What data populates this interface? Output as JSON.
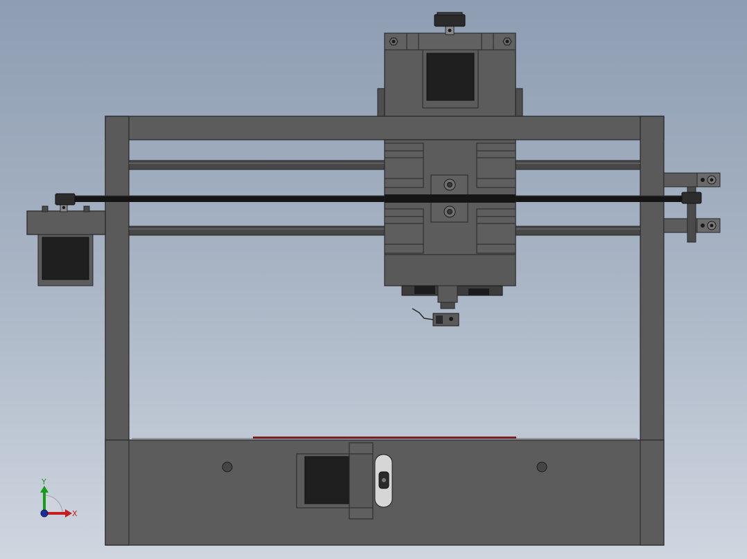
{
  "view": {
    "background_top": "#8e9db2",
    "background_bottom": "#cfd6e0"
  },
  "model": {
    "frame_color": "#5c5c5c",
    "frame_edge_color": "#262626",
    "motor_color": "#1f1f1f",
    "rod_color": "#474747",
    "belt_color": "#151515",
    "bed_accent_color": "#7a1f1f"
  },
  "triad": {
    "y_label": "Y",
    "x_label": "X",
    "y_color": "#1a9a1a",
    "x_color": "#c41e1e",
    "z_color": "#1a2f9a"
  }
}
